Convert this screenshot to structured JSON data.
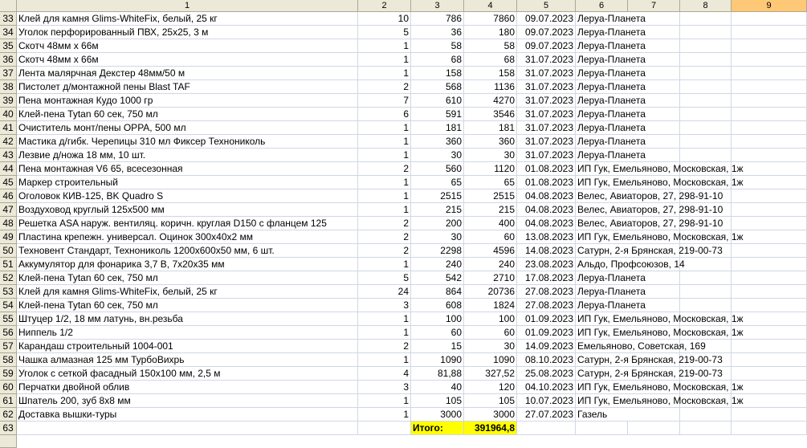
{
  "columns": [
    "1",
    "2",
    "3",
    "4",
    "5",
    "6",
    "7",
    "8",
    "9"
  ],
  "selected_column": "9",
  "rows": [
    {
      "n": "33",
      "name": "Клей для камня Glims-WhiteFix, белый, 25 кг",
      "qty": "10",
      "price": "786",
      "sum": "7860",
      "date": "09.07.2023",
      "supplier": "Леруа-Планета"
    },
    {
      "n": "34",
      "name": "Уголок перфорированный ПВХ, 25х25, 3 м",
      "qty": "5",
      "price": "36",
      "sum": "180",
      "date": "09.07.2023",
      "supplier": "Леруа-Планета"
    },
    {
      "n": "35",
      "name": "Скотч 48мм х 66м",
      "qty": "1",
      "price": "58",
      "sum": "58",
      "date": "09.07.2023",
      "supplier": "Леруа-Планета"
    },
    {
      "n": "36",
      "name": "Скотч 48мм х 66м",
      "qty": "1",
      "price": "68",
      "sum": "68",
      "date": "31.07.2023",
      "supplier": "Леруа-Планета"
    },
    {
      "n": "37",
      "name": "Лента малярчная Декстер 48мм/50 м",
      "qty": "1",
      "price": "158",
      "sum": "158",
      "date": "31.07.2023",
      "supplier": "Леруа-Планета"
    },
    {
      "n": "38",
      "name": "Пистолет д/монтажной пены Blast TAF",
      "qty": "2",
      "price": "568",
      "sum": "1136",
      "date": "31.07.2023",
      "supplier": "Леруа-Планета"
    },
    {
      "n": "39",
      "name": "Пена монтажная Кудо 1000 гр",
      "qty": "7",
      "price": "610",
      "sum": "4270",
      "date": "31.07.2023",
      "supplier": "Леруа-Планета"
    },
    {
      "n": "40",
      "name": "Клей-пена Tytan 60 сек, 750 мл",
      "qty": "6",
      "price": "591",
      "sum": "3546",
      "date": "31.07.2023",
      "supplier": "Леруа-Планета"
    },
    {
      "n": "41",
      "name": "Очиститель монт/пены OPPA, 500 мл",
      "qty": "1",
      "price": "181",
      "sum": "181",
      "date": "31.07.2023",
      "supplier": "Леруа-Планета"
    },
    {
      "n": "42",
      "name": "Мастика д/гибк. Черепицы 310 мл Фиксер Технониколь",
      "qty": "1",
      "price": "360",
      "sum": "360",
      "date": "31.07.2023",
      "supplier": "Леруа-Планета"
    },
    {
      "n": "43",
      "name": "Лезвие д/ножа 18 мм, 10 шт.",
      "qty": "1",
      "price": "30",
      "sum": "30",
      "date": "31.07.2023",
      "supplier": "Леруа-Планета"
    },
    {
      "n": "44",
      "name": "Пена монтажная V6 65, всесезонная",
      "qty": "2",
      "price": "560",
      "sum": "1120",
      "date": "01.08.2023",
      "supplier": "ИП Гук, Емельяново, Московская, 1ж"
    },
    {
      "n": "45",
      "name": "Маркер строительный",
      "qty": "1",
      "price": "65",
      "sum": "65",
      "date": "01.08.2023",
      "supplier": "ИП Гук, Емельяново, Московская, 1ж"
    },
    {
      "n": "46",
      "name": "Оголовок КИВ-125, BK Quadro S",
      "qty": "1",
      "price": "2515",
      "sum": "2515",
      "date": "04.08.2023",
      "supplier": "Велес, Авиаторов, 27, 298-91-10"
    },
    {
      "n": "47",
      "name": "Воздуховод круглый 125х500 мм",
      "qty": "1",
      "price": "215",
      "sum": "215",
      "date": "04.08.2023",
      "supplier": "Велес, Авиаторов, 27, 298-91-10"
    },
    {
      "n": "48",
      "name": "Решетка ASA наруж. вентиляц. коричн. круглая D150 с фланцем 125",
      "qty": "2",
      "price": "200",
      "sum": "400",
      "date": "04.08.2023",
      "supplier": "Велес, Авиаторов, 27, 298-91-10"
    },
    {
      "n": "49",
      "name": "Пластина крепежн. универсал. Оцинок 300х40х2 мм",
      "qty": "2",
      "price": "30",
      "sum": "60",
      "date": "13.08.2023",
      "supplier": "ИП Гук, Емельяново, Московская, 1ж"
    },
    {
      "n": "50",
      "name": "Техновент Стандарт, Технониколь 1200х600х50 мм, 6 шт.",
      "qty": "2",
      "price": "2298",
      "sum": "4596",
      "date": "14.08.2023",
      "supplier": "Сатурн, 2-я Брянская, 219-00-73"
    },
    {
      "n": "51",
      "name": "Аккумулятор для фонарика 3,7 В, 7х20х35 мм",
      "qty": "1",
      "price": "240",
      "sum": "240",
      "date": "23.08.2023",
      "supplier": "Альдо, Профсоюзов, 14"
    },
    {
      "n": "52",
      "name": "Клей-пена Tytan 60 сек, 750 мл",
      "qty": "5",
      "price": "542",
      "sum": "2710",
      "date": "17.08.2023",
      "supplier": "Леруа-Планета"
    },
    {
      "n": "53",
      "name": "Клей для камня Glims-WhiteFix, белый, 25 кг",
      "qty": "24",
      "price": "864",
      "sum": "20736",
      "date": "27.08.2023",
      "supplier": "Леруа-Планета"
    },
    {
      "n": "54",
      "name": "Клей-пена Tytan 60 сек, 750 мл",
      "qty": "3",
      "price": "608",
      "sum": "1824",
      "date": "27.08.2023",
      "supplier": "Леруа-Планета"
    },
    {
      "n": "55",
      "name": "Штуцер 1/2, 18 мм латунь, вн.резьба",
      "qty": "1",
      "price": "100",
      "sum": "100",
      "date": "01.09.2023",
      "supplier": "ИП Гук, Емельяново, Московская, 1ж"
    },
    {
      "n": "56",
      "name": "Ниппель 1/2",
      "qty": "1",
      "price": "60",
      "sum": "60",
      "date": "01.09.2023",
      "supplier": "ИП Гук, Емельяново, Московская, 1ж"
    },
    {
      "n": "57",
      "name": "Карандаш строительный 1004-001",
      "qty": "2",
      "price": "15",
      "sum": "30",
      "date": "14.09.2023",
      "supplier": "Емельяново, Советская, 169"
    },
    {
      "n": "58",
      "name": "Чашка алмазная 125 мм ТурбоВихрь",
      "qty": "1",
      "price": "1090",
      "sum": "1090",
      "date": "08.10.2023",
      "supplier": "Сатурн, 2-я Брянская, 219-00-73"
    },
    {
      "n": "59",
      "name": "Уголок с сеткой фасадный 150х100 мм, 2,5 м",
      "qty": "4",
      "price": "81,88",
      "sum": "327,52",
      "date": "25.08.2023",
      "supplier": "Сатурн, 2-я Брянская, 219-00-73"
    },
    {
      "n": "60",
      "name": "Перчатки двойной облив",
      "qty": "3",
      "price": "40",
      "sum": "120",
      "date": "04.10.2023",
      "supplier": "ИП Гук, Емельяново, Московская, 1ж"
    },
    {
      "n": "61",
      "name": "Шпатель 200, зуб 8х8 мм",
      "qty": "1",
      "price": "105",
      "sum": "105",
      "date": "10.07.2023",
      "supplier": "ИП Гук, Емельяново, Московская, 1ж"
    },
    {
      "n": "62",
      "name": "Доставка вышки-туры",
      "qty": "1",
      "price": "3000",
      "sum": "3000",
      "date": "27.07.2023",
      "supplier": "Газель"
    }
  ],
  "total_row": {
    "n": "63",
    "label": "Итого:",
    "value": "391964,8"
  },
  "colors": {
    "header_bg": "#ece9d8",
    "selected_header": "#ffc876",
    "total_highlight": "#ffff00",
    "grid": "#d0d7e5"
  }
}
